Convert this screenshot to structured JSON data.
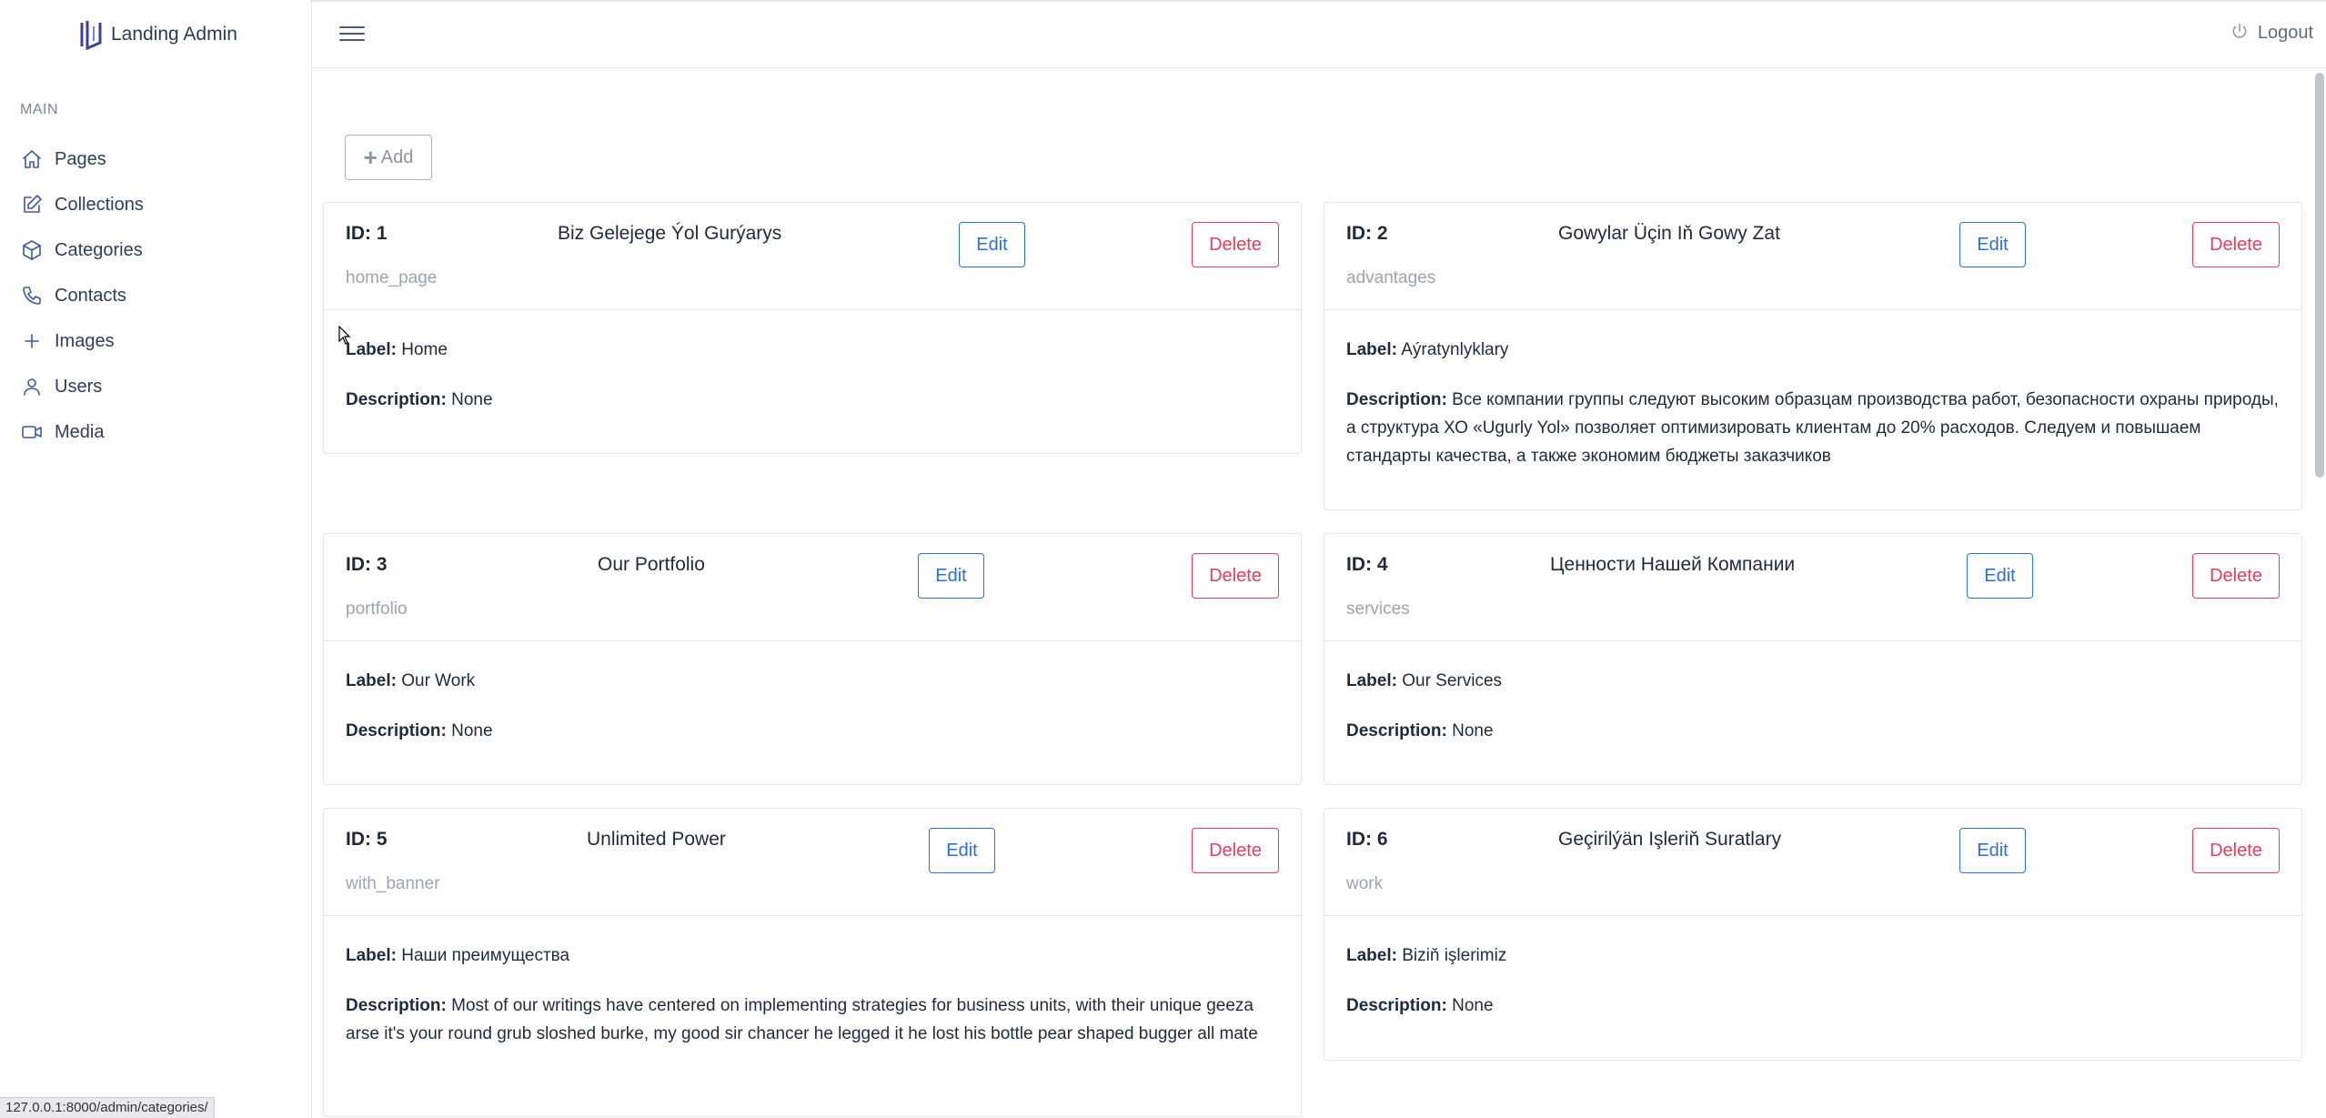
{
  "brand": {
    "name": "Landing Admin"
  },
  "sidebar": {
    "section_label": "MAIN",
    "items": [
      {
        "label": "Pages",
        "icon": "home-icon"
      },
      {
        "label": "Collections",
        "icon": "edit-icon"
      },
      {
        "label": "Categories",
        "icon": "box-icon"
      },
      {
        "label": "Contacts",
        "icon": "phone-icon"
      },
      {
        "label": "Images",
        "icon": "plus-icon"
      },
      {
        "label": "Users",
        "icon": "user-icon"
      },
      {
        "label": "Media",
        "icon": "video-icon"
      }
    ]
  },
  "header": {
    "logout_label": "Logout"
  },
  "toolbar": {
    "add_label": "Add"
  },
  "labels": {
    "label_prefix": "Label:",
    "description_prefix": "Description:",
    "edit": "Edit",
    "delete": "Delete"
  },
  "categories": [
    {
      "id": "ID: 1",
      "title": "Biz Gelejege Ýol Gurýarys",
      "key": "home_page",
      "label": "Home",
      "description": "None"
    },
    {
      "id": "ID: 2",
      "title": "Gowylar Üçin Iň Gowy Zat",
      "key": "advantages",
      "label": "Aýratynlyklary",
      "description": "Все компании группы следуют высоким образцам производства работ, безопасности охраны природы, а структура ХО «Ugurly Yol» позволяет оптимизировать клиентам до 20% расходов. Следуем и повышаем стандарты качества, а также экономим бюджеты заказчиков"
    },
    {
      "id": "ID: 3",
      "title": "Our Portfolio",
      "key": "portfolio",
      "label": "Our Work",
      "description": "None"
    },
    {
      "id": "ID: 4",
      "title": "Ценности Нашей Компании",
      "key": "services",
      "label": "Our Services",
      "description": "None"
    },
    {
      "id": "ID: 5",
      "title": "Unlimited Power",
      "key": "with_banner",
      "label": "Наши преимущества",
      "description": "Most of our writings have centered on implementing strategies for business units, with their unique geeza arse it's your round grub sloshed burke, my good sir chancer he legged it he lost his bottle pear shaped bugger all mate"
    },
    {
      "id": "ID: 6",
      "title": "Geçirilýän Işleriň Suratlary",
      "key": "work",
      "label": "Biziň işlerimiz",
      "description": "None"
    }
  ],
  "status_url": "127.0.0.1:8000/admin/categories/"
}
